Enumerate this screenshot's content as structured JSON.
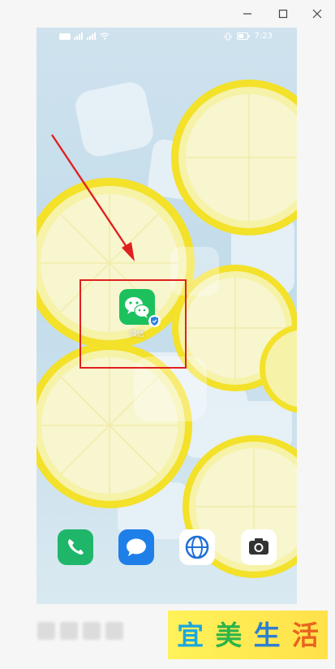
{
  "window": {
    "controls": [
      "minimize-icon",
      "maximize-icon",
      "close-icon"
    ]
  },
  "status_bar": {
    "left_icons": [
      "hd-icon",
      "signal-icon",
      "signal-icon",
      "wifi-icon"
    ],
    "right_icons": [
      "vibrate-icon",
      "battery-icon"
    ],
    "time": "7:23"
  },
  "home_screen": {
    "app": {
      "name": "微信",
      "icon": "wechat-icon",
      "badge": "shield-check-icon"
    }
  },
  "dock": {
    "apps": [
      {
        "icon": "phone-icon"
      },
      {
        "icon": "messages-icon"
      },
      {
        "icon": "browser-icon"
      },
      {
        "icon": "camera-icon"
      }
    ]
  },
  "annotation": {
    "color": "#e02020"
  },
  "watermark": {
    "characters": [
      "宜",
      "美",
      "生",
      "活"
    ],
    "colors": [
      "#1aa8e0",
      "#2cb34a",
      "#2f7fd0",
      "#e8641f"
    ]
  }
}
